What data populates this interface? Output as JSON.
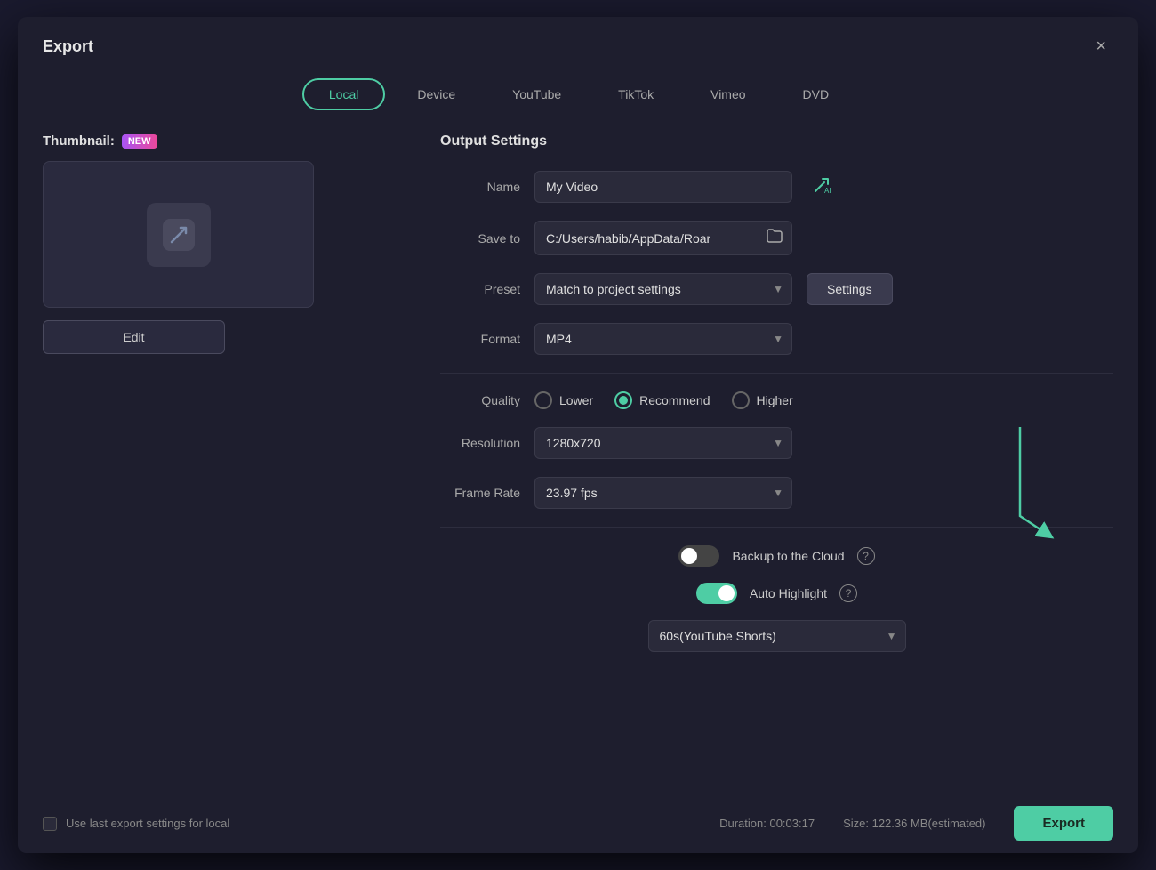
{
  "dialog": {
    "title": "Export",
    "close_label": "×"
  },
  "tabs": [
    {
      "label": "Local",
      "active": true
    },
    {
      "label": "Device",
      "active": false
    },
    {
      "label": "YouTube",
      "active": false
    },
    {
      "label": "TikTok",
      "active": false
    },
    {
      "label": "Vimeo",
      "active": false
    },
    {
      "label": "DVD",
      "active": false
    }
  ],
  "left_panel": {
    "thumbnail_label": "Thumbnail:",
    "new_badge": "NEW",
    "edit_btn": "Edit"
  },
  "right_panel": {
    "section_title": "Output Settings",
    "fields": {
      "name_label": "Name",
      "name_value": "My Video",
      "save_to_label": "Save to",
      "save_to_value": "C:/Users/habib/AppData/Roar",
      "preset_label": "Preset",
      "preset_value": "Match to project settings",
      "settings_btn": "Settings",
      "format_label": "Format",
      "format_value": "MP4",
      "quality_label": "Quality",
      "quality_options": [
        {
          "label": "Lower",
          "checked": false
        },
        {
          "label": "Recommend",
          "checked": true
        },
        {
          "label": "Higher",
          "checked": false
        }
      ],
      "resolution_label": "Resolution",
      "resolution_value": "1280x720",
      "frame_rate_label": "Frame Rate",
      "frame_rate_value": "23.97 fps"
    },
    "toggles": {
      "backup_label": "Backup to the Cloud",
      "backup_on": false,
      "auto_highlight_label": "Auto Highlight",
      "auto_highlight_on": true
    },
    "highlight_select_value": "60s(YouTube Shorts)"
  },
  "footer": {
    "use_last_label": "Use last export settings for local",
    "duration_label": "Duration: 00:03:17",
    "size_label": "Size: 122.36 MB(estimated)",
    "export_btn": "Export"
  }
}
